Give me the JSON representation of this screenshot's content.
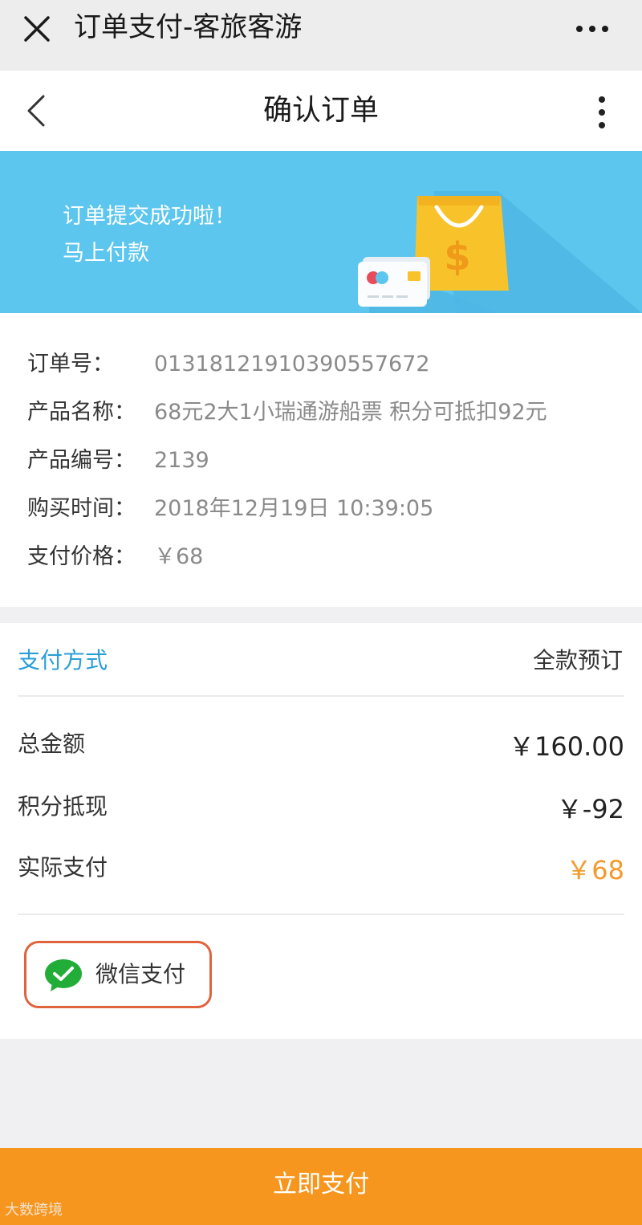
{
  "wechat_bar": {
    "title": "订单支付-客旅客游",
    "close_icon": "close-icon",
    "more_icon": "more-horizontal-icon"
  },
  "nav": {
    "title": "确认订单",
    "back_icon": "chevron-left-icon",
    "more_icon": "more-vertical-icon"
  },
  "banner": {
    "line1": "订单提交成功啦！",
    "line2": "马上付款",
    "accent": "#5cc6ef"
  },
  "order_info": {
    "rows": [
      {
        "label": "订单号：",
        "value": "01318121910390557672"
      },
      {
        "label": "产品名称：",
        "value": "68元2大1小瑞通游船票 积分可抵扣92元"
      },
      {
        "label": "产品编号：",
        "value": "2139"
      },
      {
        "label": "购买时间：",
        "value": "2018年12月19日 10:39:05"
      },
      {
        "label": "支付价格：",
        "value": "￥68"
      }
    ]
  },
  "payment": {
    "method_label": "支付方式",
    "method_value": "全款预订",
    "amounts": [
      {
        "label": "总金额",
        "value": "￥160.00"
      },
      {
        "label": "积分抵现",
        "value": "￥-92"
      },
      {
        "label": "实际支付",
        "value": "￥68"
      }
    ],
    "wechat_pay": {
      "label": "微信支付",
      "icon": "wechat-pay-icon"
    }
  },
  "pay_now": {
    "label": "立即支付",
    "color": "#f7961e"
  },
  "watermark": "大数跨境"
}
